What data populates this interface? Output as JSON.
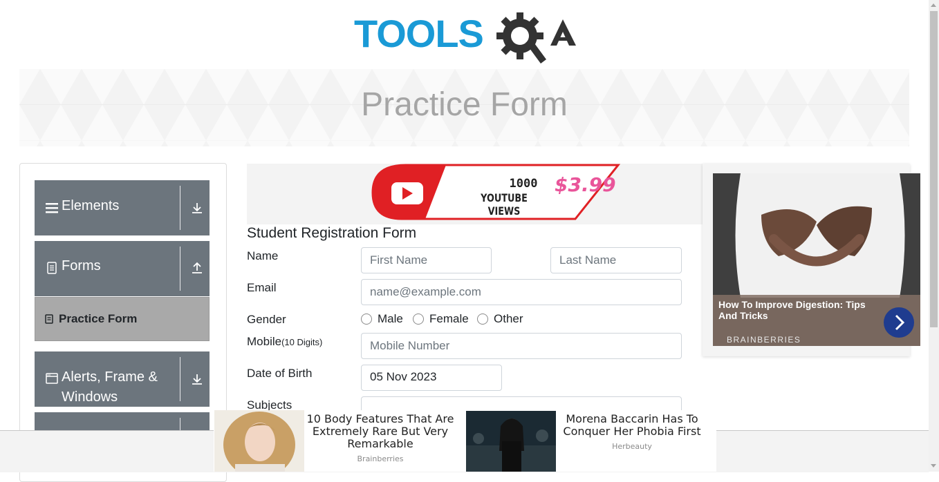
{
  "logo": {
    "text": "TOOLSQA",
    "brand_color": "#1a9ad6",
    "dark_color": "#333333"
  },
  "banner": {
    "title": "Practice Form"
  },
  "sidebar": {
    "groups": [
      {
        "label": "Elements",
        "icon": "hamburger-icon",
        "arrow": "download-icon"
      },
      {
        "label": "Forms",
        "icon": "document-icon",
        "arrow": "upload-icon"
      },
      {
        "label": "Alerts, Frame &",
        "label2": "Windows",
        "icon": "window-icon",
        "arrow": "download-icon"
      }
    ],
    "active_item": {
      "label": "Practice Form",
      "icon": "form-icon"
    }
  },
  "ads": {
    "youtube": {
      "line1": "1000",
      "line2": "YOUTUBE VIEWS",
      "price": "$3.99"
    },
    "right": {
      "title": "How To Improve Digestion: Tips And Tricks",
      "source": "BRAINBERRIES"
    },
    "bottom": [
      {
        "title": "10 Body Features That Are Extremely Rare But Very Remarkable",
        "source": "Brainberries"
      },
      {
        "title": "Morena Baccarin Has To Conquer Her Phobia First",
        "source": "Herbeauty"
      }
    ]
  },
  "form": {
    "title": "Student Registration Form",
    "name_label": "Name",
    "first_name_placeholder": "First Name",
    "last_name_placeholder": "Last Name",
    "email_label": "Email",
    "email_placeholder": "name@example.com",
    "gender_label": "Gender",
    "gender_options": [
      "Male",
      "Female",
      "Other"
    ],
    "mobile_label": "Mobile",
    "mobile_hint": "(10 Digits)",
    "mobile_placeholder": "Mobile Number",
    "dob_label": "Date of Birth",
    "dob_value": "05 Nov 2023",
    "subjects_label": "Subjects"
  }
}
